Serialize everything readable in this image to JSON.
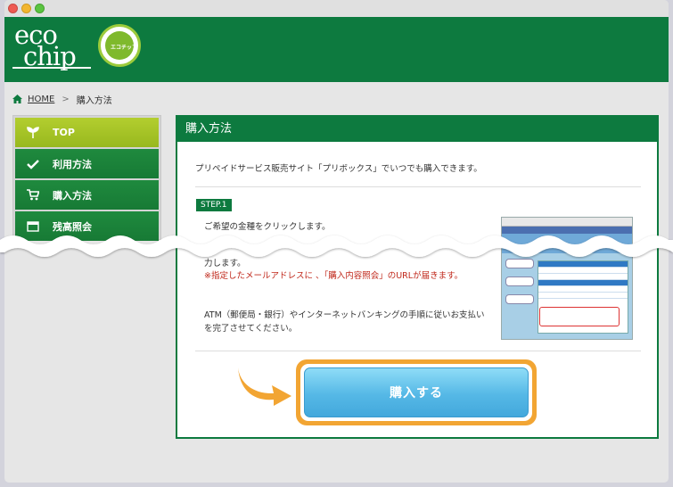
{
  "brand": {
    "logo_line1": "eco",
    "logo_line2": "chip",
    "badge_text": "エコチップ"
  },
  "breadcrumb": {
    "home": "HOME",
    "current": "購入方法"
  },
  "sidebar": {
    "items": [
      {
        "label": "TOP",
        "icon": "sprout-icon",
        "active": true
      },
      {
        "label": "利用方法",
        "icon": "check-icon",
        "active": false
      },
      {
        "label": "購入方法",
        "icon": "cart-icon",
        "active": false
      },
      {
        "label": "残高照会",
        "icon": "window-icon",
        "active": false
      }
    ]
  },
  "main": {
    "title": "購入方法",
    "intro": "プリペイドサービス販売サイト「プリボックス」でいつでも購入できます。",
    "step_label": "STEP.1",
    "step_text1": "ご希望の金種をクリックします。",
    "step_text2": "力します。",
    "warning": "※指定したメールアドレスに 、「購入内容照会」のURLが届きます。",
    "atm_text": "ATM（郵便局・銀行）やインターネットバンキングの手順に従いお支払いを完了させてください。",
    "cta_label": "購入する"
  },
  "colors": {
    "header_green": "#0d7a3f",
    "active_lime": "#a9c627",
    "cta_orange": "#f2a533",
    "cta_blue": "#55b8e6",
    "warning_red": "#c0281b"
  }
}
